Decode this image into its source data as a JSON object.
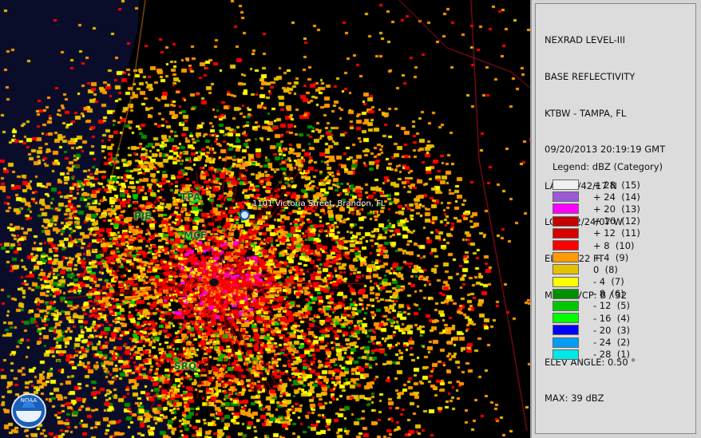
{
  "info": {
    "product": "NEXRAD LEVEL-III",
    "type": "BASE REFLECTIVITY",
    "station": "KTBW - TAMPA, FL",
    "datetime": "09/20/2013 20:19:19 GMT",
    "lat": "LAT: 27/42/17 N",
    "lon": "LON: 82/24/07 W",
    "elev": "ELEV: 122 FT",
    "mode": "MODE/VCP: B / 32",
    "elev_angle": "ELEV ANGLE: 0.50 °",
    "max": "MAX: 39 dBZ"
  },
  "legend": {
    "title": "Legend: dBZ (Category)",
    "items": [
      {
        "label": "+ 28  (15)",
        "color": "#f0f0f0"
      },
      {
        "label": "+ 24  (14)",
        "color": "#9c59d6"
      },
      {
        "label": "+ 20  (13)",
        "color": "#ff00ff"
      },
      {
        "label": "+ 16  (12)",
        "color": "#c40000"
      },
      {
        "label": "+ 12  (11)",
        "color": "#d80000"
      },
      {
        "label": "+ 8  (10)",
        "color": "#ff0000"
      },
      {
        "label": "+ 4  (9)",
        "color": "#ff9a00"
      },
      {
        "label": "0  (8)",
        "color": "#e7c000"
      },
      {
        "label": "- 4  (7)",
        "color": "#ffff00"
      },
      {
        "label": "- 8  (6)",
        "color": "#008f00"
      },
      {
        "label": "- 12  (5)",
        "color": "#00c800"
      },
      {
        "label": "- 16  (4)",
        "color": "#00ff00"
      },
      {
        "label": "- 20  (3)",
        "color": "#0000f5"
      },
      {
        "label": "- 24  (2)",
        "color": "#009ef5"
      },
      {
        "label": "- 28  (1)",
        "color": "#00e8e8"
      }
    ]
  },
  "map": {
    "cities": [
      "TPA",
      "PIE",
      "MCF",
      "SRQ"
    ],
    "address": "1101 Victoria Street, Brandon, FL",
    "logo_text": "NOAA"
  }
}
